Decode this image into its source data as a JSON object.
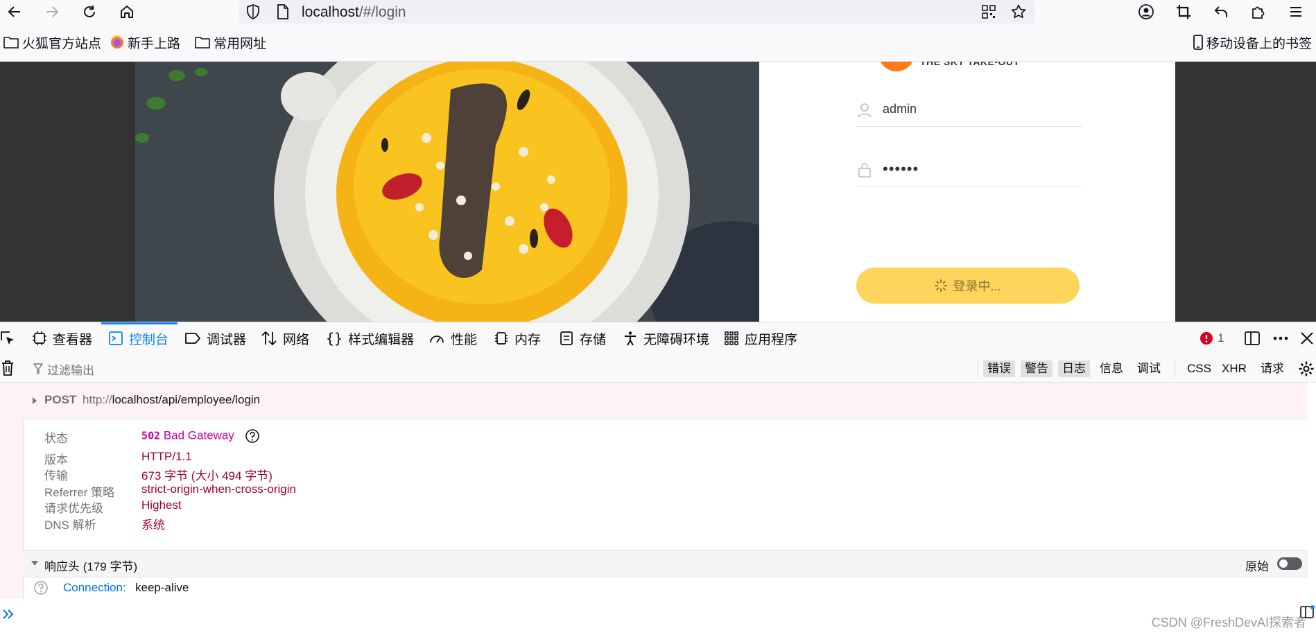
{
  "browser": {
    "url_host": "localhost",
    "url_path": "/#/login"
  },
  "bookmarks": {
    "items": [
      {
        "label": "火狐官方站点"
      },
      {
        "label": "新手上路"
      },
      {
        "label": "常用网址"
      }
    ],
    "mobile_label": "移动设备上的书签"
  },
  "login": {
    "brand_text": "THE SKY TAKE-OUT",
    "username": "admin",
    "password_mask": "••••••",
    "button_label": "登录中..."
  },
  "devtools": {
    "tabs": [
      {
        "label": "查看器"
      },
      {
        "label": "控制台"
      },
      {
        "label": "调试器"
      },
      {
        "label": "网络"
      },
      {
        "label": "样式编辑器"
      },
      {
        "label": "性能"
      },
      {
        "label": "内存"
      },
      {
        "label": "存储"
      },
      {
        "label": "无障碍环境"
      },
      {
        "label": "应用程序"
      }
    ],
    "error_count": "1",
    "filter_placeholder": "过滤输出",
    "filters": [
      "错误",
      "警告",
      "日志",
      "信息",
      "调试",
      "CSS",
      "XHR",
      "请求"
    ],
    "request": {
      "method": "POST",
      "url_scheme": "http://",
      "url_rest": "localhost/api/employee/login"
    },
    "details": [
      {
        "label": "状态",
        "code": "502",
        "value": "Bad Gateway"
      },
      {
        "label": "版本",
        "value": "HTTP/1.1"
      },
      {
        "label": "传输",
        "value": "673 字节 (大小 494 字节)"
      },
      {
        "label": "Referrer 策略",
        "value": "strict-origin-when-cross-origin"
      },
      {
        "label": "请求优先级",
        "value": "Highest"
      },
      {
        "label": "DNS 解析",
        "value": "系统"
      }
    ],
    "response_headers_title": "响应头 (179 字节)",
    "raw_label": "原始",
    "header_name": "Connection:",
    "header_value": "keep-alive"
  },
  "watermark": "CSDN @FreshDevAI探索者",
  "colors": {
    "accent": "#0a84ff",
    "error": "#d70022",
    "login_button": "#fdd55d",
    "value_red": "#a50026",
    "status_magenta": "#c900a5"
  }
}
